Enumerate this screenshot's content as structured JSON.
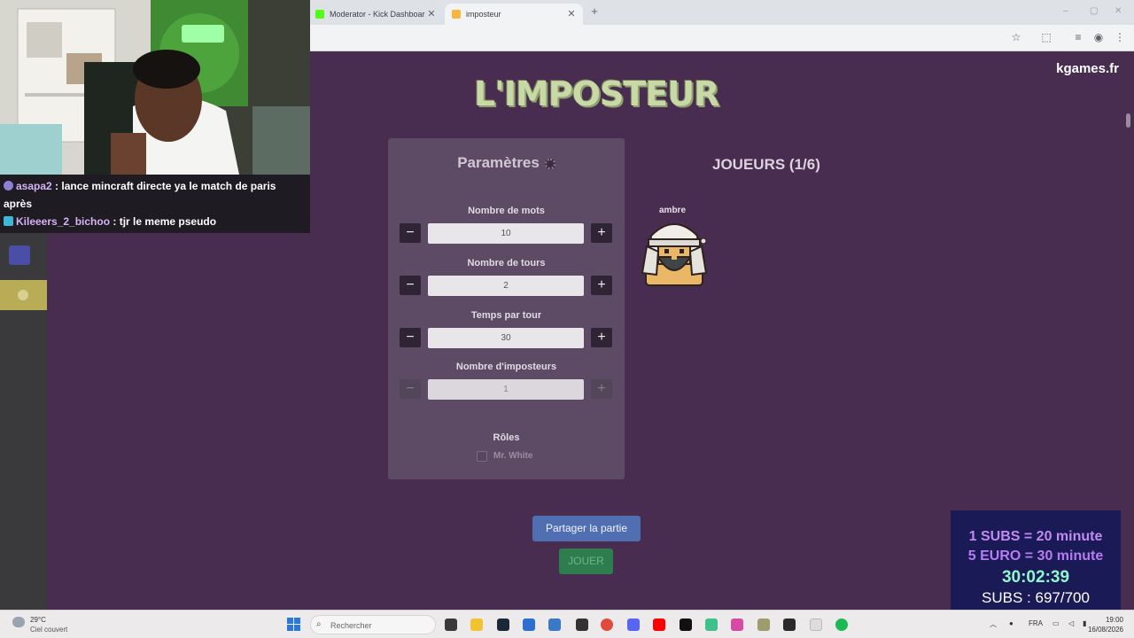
{
  "browser": {
    "tabs": [
      {
        "label": "Moderator - Kick Dashboard",
        "favicon_color": "#53fc18",
        "active": false
      },
      {
        "label": "imposteur",
        "favicon_color": "#f4b740",
        "active": true
      }
    ],
    "new_tab": "+",
    "window_controls": [
      "–",
      "▢",
      "✕"
    ]
  },
  "page": {
    "brand": "kgames.fr",
    "logo": "L'IMPOSTEUR",
    "params": {
      "title": "Paramètres",
      "fields": [
        {
          "label": "Nombre de mots",
          "value": "10",
          "enabled": true
        },
        {
          "label": "Nombre de tours",
          "value": "2",
          "enabled": true
        },
        {
          "label": "Temps par tour",
          "value": "30",
          "enabled": true
        },
        {
          "label": "Nombre d'imposteurs",
          "value": "1",
          "enabled": false
        }
      ],
      "minus": "−",
      "plus": "+",
      "roles_label": "Rôles",
      "role_option": "Mr. White"
    },
    "players": {
      "title": "JOUEURS (1/6)",
      "list": [
        {
          "name": "ambre"
        }
      ]
    },
    "share_button": "Partager la partie",
    "play_button": "JOUER"
  },
  "overlay": {
    "chat": [
      {
        "user": "asapa2",
        "message": " : lance mincraft directe ya le match de paris après",
        "badge_color": "#8e7fd6"
      },
      {
        "user": "Kileeers_2_bichoo",
        "message": " : tjr le meme pseudo",
        "badge_color": "#3fb6d6"
      }
    ],
    "subs": {
      "line1": "1 SUBS = 20 minute",
      "line2": "5 EURO = 30 minute",
      "timer": "30:02:39",
      "count": "SUBS : 697/700"
    }
  },
  "taskbar": {
    "weather_temp": "29°C",
    "weather_desc": "Ciel couvert",
    "search_placeholder": "Rechercher",
    "language": "FRA",
    "time": "19:00",
    "date": "16/08/2026"
  }
}
